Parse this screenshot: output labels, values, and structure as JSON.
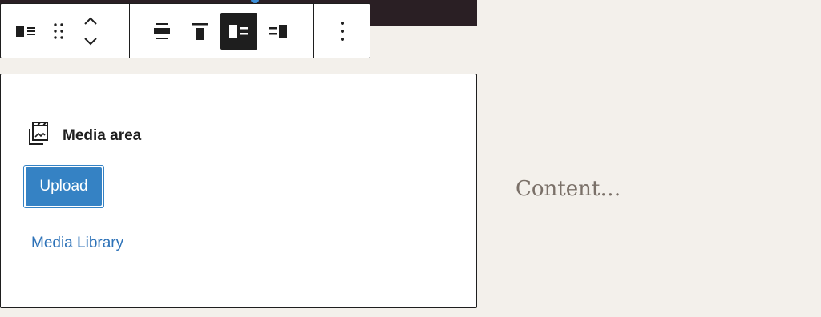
{
  "toolbar": {
    "group1": [
      {
        "name": "block-type-icon",
        "label": "Media & Text"
      },
      {
        "name": "drag-handle-icon",
        "label": "Drag"
      },
      {
        "name": "move-up-down-icon",
        "label": "Move up/down"
      }
    ],
    "group2": [
      {
        "name": "align-center-icon",
        "label": "Align center"
      },
      {
        "name": "align-top-icon",
        "label": "Align top"
      },
      {
        "name": "media-left-icon",
        "label": "Show media on left",
        "active": true
      },
      {
        "name": "media-right-icon",
        "label": "Show media on right"
      }
    ],
    "group3": [
      {
        "name": "more-options-icon",
        "label": "Options"
      }
    ]
  },
  "placeholder": {
    "title": "Media area",
    "upload_label": "Upload",
    "library_label": "Media Library"
  },
  "content": {
    "placeholder_text": "Content…"
  },
  "colors": {
    "page_bg": "#f3f0eb",
    "accent": "#3582c4",
    "link": "#2d72b8",
    "dark": "#1e1e1e"
  }
}
